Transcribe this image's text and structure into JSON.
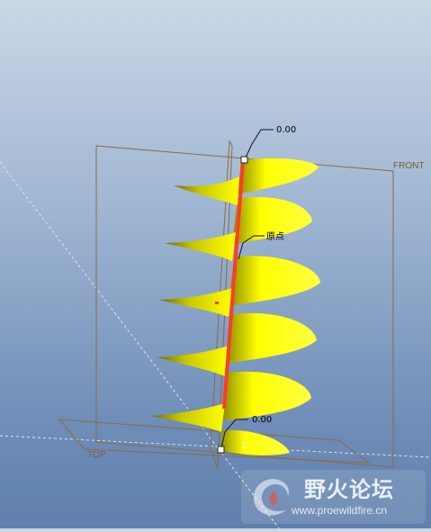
{
  "datum_planes": {
    "front": "FRONT",
    "top": "TOP"
  },
  "origin_label": "原点",
  "dimensions": {
    "top_value": "0.00",
    "bottom_value": "0.00"
  },
  "partial_label": "1",
  "watermark": {
    "title": "野火论坛",
    "url": "www.proewildfire.cn"
  },
  "colors": {
    "surface": "#ffff00",
    "trajectory": "#ff3b2b",
    "datum_plane": "#8a6b48",
    "background_top": "#cad7e6",
    "background_bottom": "#5f7fad"
  }
}
